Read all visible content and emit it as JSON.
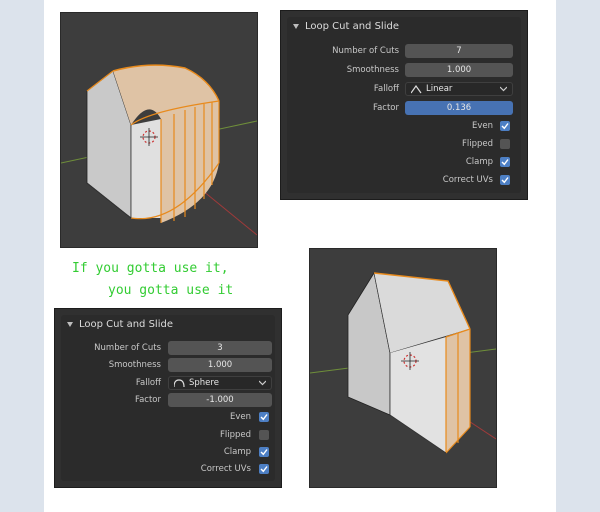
{
  "colors": {
    "panel_bg": "#303030",
    "field": "#545454",
    "accent": "#4772b3",
    "check_on": "#4d7fc4",
    "caption": "#33cc33",
    "edge_select": "#e88a1c"
  },
  "panel_top": {
    "title": "Loop Cut and Slide",
    "rows": [
      {
        "label": "Number of Cuts",
        "value": "7"
      },
      {
        "label": "Smoothness",
        "value": "1.000"
      },
      {
        "label": "Falloff",
        "value": "Linear",
        "icon": "linear-falloff-icon"
      },
      {
        "label": "Factor",
        "value": "0.136"
      }
    ],
    "checks": [
      {
        "label": "Even",
        "checked": true
      },
      {
        "label": "Flipped",
        "checked": false
      },
      {
        "label": "Clamp",
        "checked": true
      },
      {
        "label": "Correct UVs",
        "checked": true
      }
    ]
  },
  "panel_bottom": {
    "title": "Loop Cut and Slide",
    "rows": [
      {
        "label": "Number of Cuts",
        "value": "3"
      },
      {
        "label": "Smoothness",
        "value": "1.000"
      },
      {
        "label": "Falloff",
        "value": "Sphere",
        "icon": "sphere-falloff-icon"
      },
      {
        "label": "Factor",
        "value": "-1.000"
      }
    ],
    "checks": [
      {
        "label": "Even",
        "checked": true
      },
      {
        "label": "Flipped",
        "checked": false
      },
      {
        "label": "Clamp",
        "checked": true
      },
      {
        "label": "Correct UVs",
        "checked": true
      }
    ]
  },
  "caption": {
    "line1": "If you gotta use it,",
    "line2": "you gotta use it"
  }
}
